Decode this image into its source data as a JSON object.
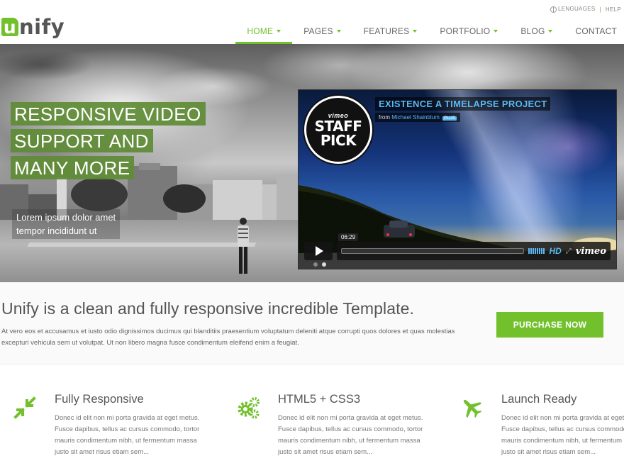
{
  "topbar": {
    "languages_label": "LENGUAGES",
    "separator": "|",
    "help_label": "HELP"
  },
  "logo": {
    "first_letter": "u",
    "rest": "nify",
    "accent_color": "#72c02c"
  },
  "nav": {
    "items": [
      {
        "label": "HOME",
        "active": true,
        "dropdown": true
      },
      {
        "label": "PAGES",
        "active": false,
        "dropdown": true
      },
      {
        "label": "FEATURES",
        "active": false,
        "dropdown": true
      },
      {
        "label": "PORTFOLIO",
        "active": false,
        "dropdown": true
      },
      {
        "label": "BLOG",
        "active": false,
        "dropdown": true
      },
      {
        "label": "CONTACT",
        "active": false,
        "dropdown": false
      }
    ]
  },
  "hero": {
    "headline_lines": [
      "RESPONSIVE VIDEO",
      "SUPPORT AND",
      "MANY MORE"
    ],
    "subtext_lines": [
      "Lorem ipsum dolor amet",
      "tempor incididunt ut"
    ],
    "slider_dots": 2,
    "active_dot": 1
  },
  "video": {
    "badge_brand": "vimeo",
    "badge_line1": "STAFF",
    "badge_line2": "PICK",
    "title": "EXISTENCE A TIMELAPSE PROJECT",
    "from_label": "from",
    "author": "Michael Shainblum",
    "plus_badge": "PLUS",
    "time": "06:29",
    "hd_label": "HD",
    "brand_label": "vimeo"
  },
  "purchase": {
    "heading": "Unify is a clean and fully responsive incredible Template.",
    "body": "At vero eos et accusamus et iusto odio dignissimos ducimus qui blanditiis praesentium voluptatum deleniti atque corrupti quos dolores et quas molestias excepturi vehicula sem ut volutpat. Ut non libero magna fusce condimentum eleifend enim a feugiat.",
    "button_label": "PURCHASE NOW"
  },
  "features": [
    {
      "icon": "compress-arrows-icon",
      "title": "Fully Responsive",
      "text": "Donec id elit non mi porta gravida at eget metus. Fusce dapibus, tellus ac cursus commodo, tortor mauris condimentum nibh, ut fermentum massa justo sit amet risus etiam sem..."
    },
    {
      "icon": "gears-icon",
      "title": "HTML5 + CSS3",
      "text": "Donec id elit non mi porta gravida at eget metus. Fusce dapibus, tellus ac cursus commodo, tortor mauris condimentum nibh, ut fermentum massa justo sit amet risus etiam sem..."
    },
    {
      "icon": "plane-icon",
      "title": "Launch Ready",
      "text": "Donec id elit non mi porta gravida at eget metus. Fusce dapibus, tellus ac cursus commodo, tortor mauris condimentum nibh, ut fermentum massa justo sit amet risus etiam sem..."
    }
  ]
}
